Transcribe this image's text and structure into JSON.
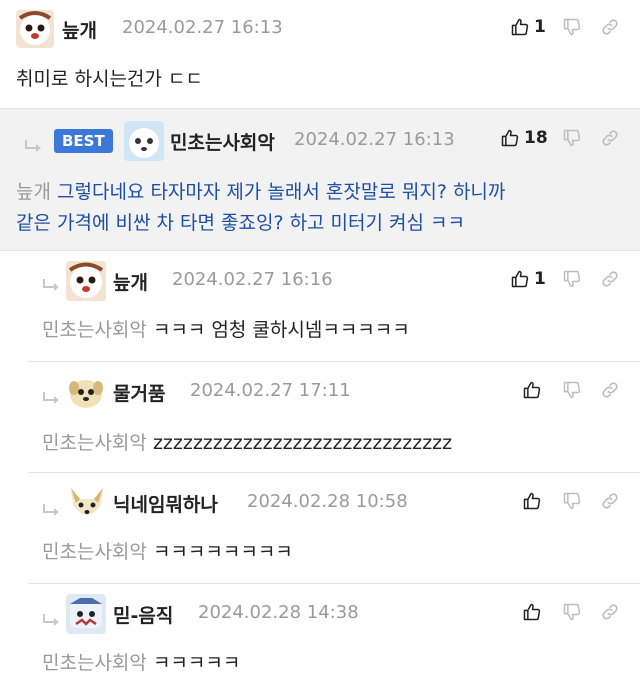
{
  "comments": [
    {
      "nick": "늪개",
      "date": "2024.02.27 16:13",
      "likes": "1",
      "body": "취미로 하시는건가 ㄷㄷ"
    },
    {
      "badge": "BEST",
      "nick": "민초는사회악",
      "date": "2024.02.27 16:13",
      "likes": "18",
      "mention": "늪개",
      "body_line1": "그렇다네요 타자마자 제가 놀래서 혼잣말로 뭐지? 하니까",
      "body_line2": "같은 가격에 비싼 차 타면 좋죠잉? 하고 미터기 켜심 ㅋㅋ"
    },
    {
      "nick": "늪개",
      "date": "2024.02.27 16:16",
      "likes": "1",
      "mention": "민초는사회악",
      "body": "ㅋㅋㅋ 엄청 쿨하시넴ㅋㅋㅋㅋㅋ"
    },
    {
      "nick": "물거품",
      "date": "2024.02.27 17:11",
      "mention": "민초는사회악",
      "body": "zzzzzzzzzzzzzzzzzzzzzzzzzzzzzz"
    },
    {
      "nick": "닉네임뭐하나",
      "date": "2024.02.28 10:58",
      "mention": "민초는사회악",
      "body": "ㅋㅋㅋㅋㅋㅋㅋㅋ"
    },
    {
      "nick": "믿-음직",
      "date": "2024.02.28 14:38",
      "mention": "민초는사회악",
      "body": "ㅋㅋㅋㅋㅋ"
    }
  ],
  "colors": {
    "accent": "#3b78d8",
    "link_text": "#1d4fa6",
    "muted": "#9a9a9a",
    "best_bg": "#f2f2f2"
  },
  "icons": [
    "reply-arrow-icon",
    "thumbs-up-icon",
    "thumbs-down-icon",
    "link-icon"
  ]
}
